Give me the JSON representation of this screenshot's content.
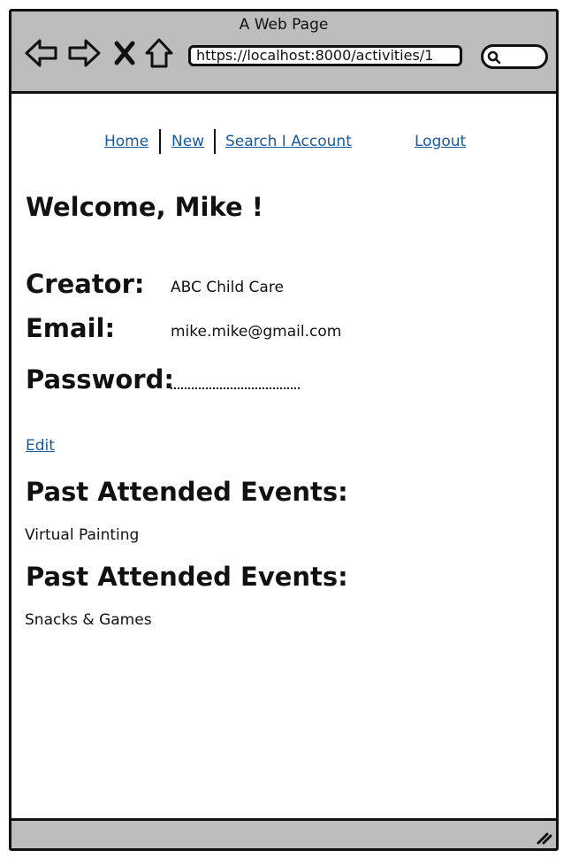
{
  "window": {
    "title": "A Web Page"
  },
  "browser": {
    "url": "https://localhost:8000/activities/1",
    "icons": {
      "back": "back-arrow-icon",
      "forward": "forward-arrow-icon",
      "stop": "close-icon",
      "home": "home-icon",
      "search": "search-icon"
    }
  },
  "nav": {
    "home": "Home",
    "new": "New",
    "search_account": "Search I Account",
    "logout": "Logout"
  },
  "profile": {
    "welcome": "Welcome, Mike !",
    "creator_label": "Creator:",
    "creator_value": "ABC Child Care",
    "email_label": "Email:",
    "email_value": "mike.mike@gmail.com",
    "password_label": "Password:",
    "edit": "Edit"
  },
  "events": [
    {
      "heading": "Past Attended Events:",
      "item": "Virtual Painting"
    },
    {
      "heading": "Past Attended Events:",
      "item": "Snacks & Games"
    }
  ],
  "colors": {
    "link": "#1a5aa0",
    "chrome": "#bdbdbd",
    "border": "#111111"
  }
}
